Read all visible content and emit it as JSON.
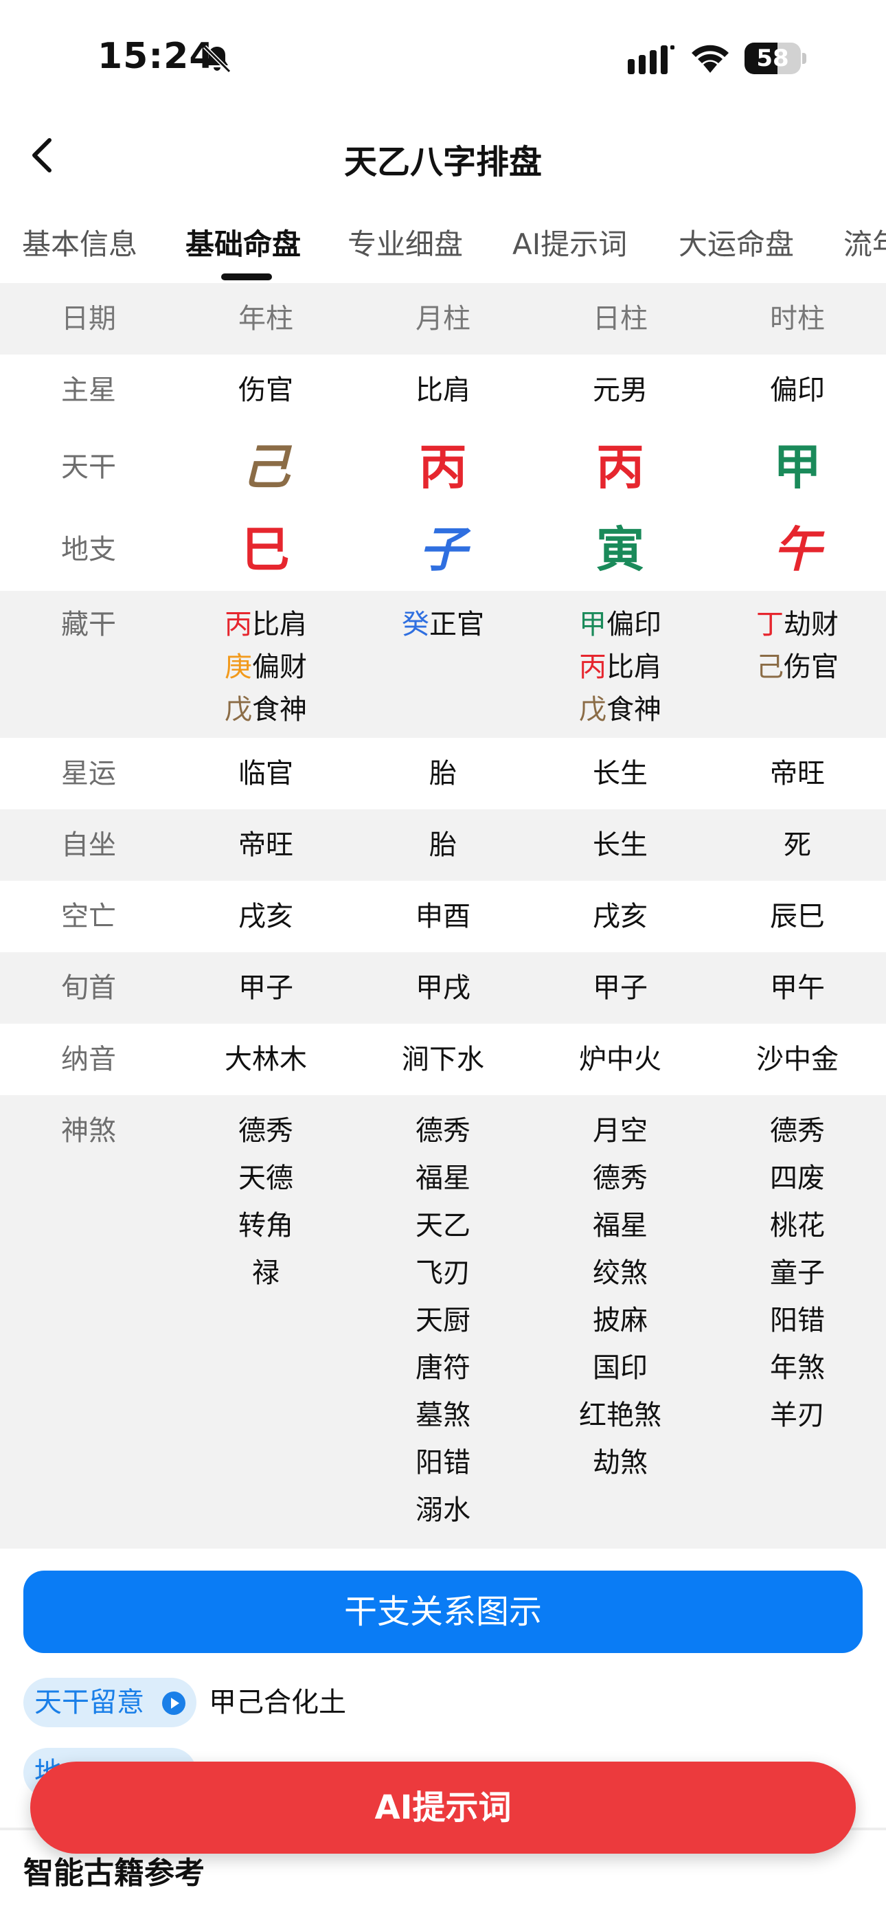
{
  "status": {
    "time": "15:24",
    "battery": "58",
    "battery_level": 0.58
  },
  "nav": {
    "title": "天乙八字排盘"
  },
  "tabs": [
    {
      "label": "基本信息",
      "active": false
    },
    {
      "label": "基础命盘",
      "active": true
    },
    {
      "label": "专业细盘",
      "active": false
    },
    {
      "label": "AI提示词",
      "active": false
    },
    {
      "label": "大运命盘",
      "active": false
    },
    {
      "label": "流年",
      "active": false
    }
  ],
  "colors": {
    "wood": "#1a8a5a",
    "fire": "#e6262e",
    "earth": "#8b6c46",
    "metal": "#f29a1c",
    "water": "#2f6fe0",
    "accent_blue": "#0a7cf5",
    "accent_red": "#ec3a3d"
  },
  "table": {
    "header": [
      "日期",
      "年柱",
      "月柱",
      "日柱",
      "时柱"
    ],
    "zhuxing": {
      "label": "主星",
      "values": [
        "伤官",
        "比肩",
        "元男",
        "偏印"
      ]
    },
    "tiangan": {
      "label": "天干",
      "values": [
        {
          "char": "己",
          "color": "#8b6c46"
        },
        {
          "char": "丙",
          "color": "#e6262e"
        },
        {
          "char": "丙",
          "color": "#e6262e"
        },
        {
          "char": "甲",
          "color": "#1a8a5a"
        }
      ]
    },
    "dizhi": {
      "label": "地支",
      "values": [
        {
          "char": "巳",
          "color": "#e6262e"
        },
        {
          "char": "子",
          "color": "#2f6fe0"
        },
        {
          "char": "寅",
          "color": "#1a8a5a"
        },
        {
          "char": "午",
          "color": "#e6262e"
        }
      ]
    },
    "canggan": {
      "label": "藏干",
      "values": [
        [
          {
            "gan": "丙",
            "color": "#e6262e",
            "shen": "比肩"
          },
          {
            "gan": "庚",
            "color": "#f29a1c",
            "shen": "偏财"
          },
          {
            "gan": "戊",
            "color": "#8b6c46",
            "shen": "食神"
          }
        ],
        [
          {
            "gan": "癸",
            "color": "#2f6fe0",
            "shen": "正官"
          }
        ],
        [
          {
            "gan": "甲",
            "color": "#1a8a5a",
            "shen": "偏印"
          },
          {
            "gan": "丙",
            "color": "#e6262e",
            "shen": "比肩"
          },
          {
            "gan": "戊",
            "color": "#8b6c46",
            "shen": "食神"
          }
        ],
        [
          {
            "gan": "丁",
            "color": "#e6262e",
            "shen": "劫财"
          },
          {
            "gan": "己",
            "color": "#8b6c46",
            "shen": "伤官"
          }
        ]
      ]
    },
    "xingyun": {
      "label": "星运",
      "values": [
        "临官",
        "胎",
        "长生",
        "帝旺"
      ]
    },
    "zizuo": {
      "label": "自坐",
      "values": [
        "帝旺",
        "胎",
        "长生",
        "死"
      ]
    },
    "kongwang": {
      "label": "空亡",
      "values": [
        "戌亥",
        "申酉",
        "戌亥",
        "辰巳"
      ]
    },
    "xunshou": {
      "label": "旬首",
      "values": [
        "甲子",
        "甲戌",
        "甲子",
        "甲午"
      ]
    },
    "nayin": {
      "label": "纳音",
      "values": [
        "大林木",
        "涧下水",
        "炉中火",
        "沙中金"
      ]
    },
    "shensha": {
      "label": "神煞",
      "values": [
        [
          "德秀",
          "天德",
          "转角",
          "禄"
        ],
        [
          "德秀",
          "福星",
          "天乙",
          "飞刃",
          "天厨",
          "唐符",
          "墓煞",
          "阳错",
          "溺水"
        ],
        [
          "月空",
          "德秀",
          "福星",
          "绞煞",
          "披麻",
          "国印",
          "红艳煞",
          "劫煞"
        ],
        [
          "德秀",
          "四废",
          "桃花",
          "童子",
          "阳错",
          "年煞",
          "羊刃"
        ]
      ]
    }
  },
  "actions": {
    "ganzhi_button": "干支关系图示",
    "chip1_label": "天干留意",
    "chip1_text": "甲己合化土",
    "chip2_label": "地",
    "ai_button": "AI提示词",
    "section_title": "智能古籍参考"
  }
}
